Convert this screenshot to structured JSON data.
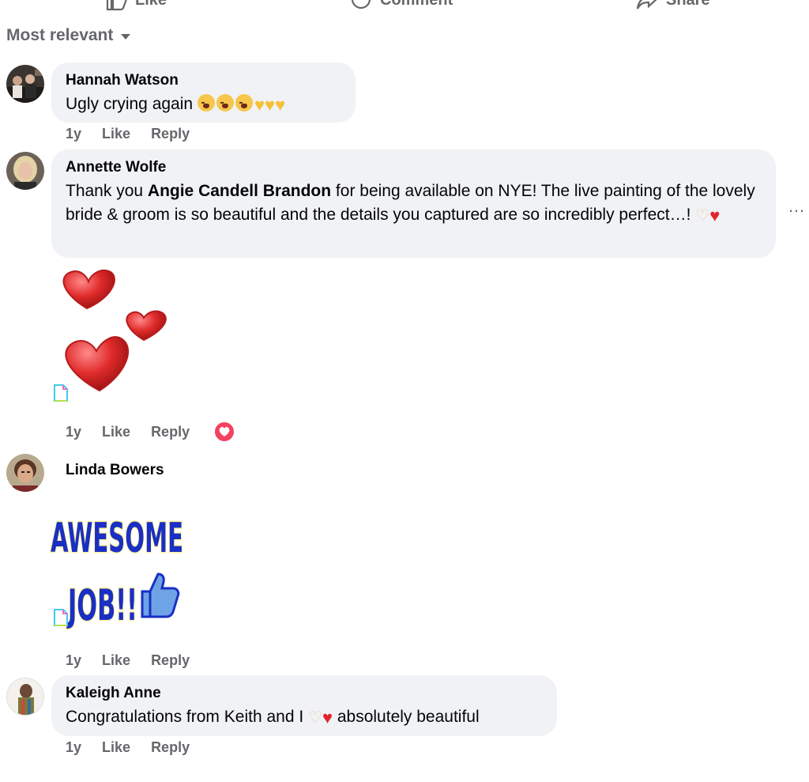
{
  "action_bar": {
    "like_label": "Like",
    "comment_label": "Comment",
    "share_label": "Share"
  },
  "sort": {
    "label": "Most relevant"
  },
  "comments": [
    {
      "author": "Hannah Watson",
      "text": "Ugly crying again",
      "time": "1y",
      "like": "Like",
      "reply": "Reply"
    },
    {
      "author": "Annette Wolfe",
      "text_parts": [
        "Thank you ",
        "Angie Candell Brandon",
        " for being available on NYE! The live painting of the lovely bride & groom is so beautiful and the details you captured are so incredibly perfect…! "
      ],
      "time": "1y",
      "like": "Like",
      "reply": "Reply",
      "reaction": "love"
    },
    {
      "author": "Linda Bowers",
      "sticker_text_1": "AWESOME",
      "sticker_text_2": "JOB!!",
      "time": "1y",
      "like": "Like",
      "reply": "Reply"
    },
    {
      "author": "Kaleigh Anne",
      "text_before": "Congratulations from Keith and I ",
      "text_after": " absolutely beautiful",
      "time": "1y",
      "like": "Like",
      "reply": "Reply"
    }
  ],
  "more_menu": "…",
  "colors": {
    "bubble": "#f0f2f5",
    "meta": "#65676b",
    "love": "#f3425f",
    "sticker_blue": "#1a2fc4",
    "sticker_glow": "#fff3a0"
  }
}
